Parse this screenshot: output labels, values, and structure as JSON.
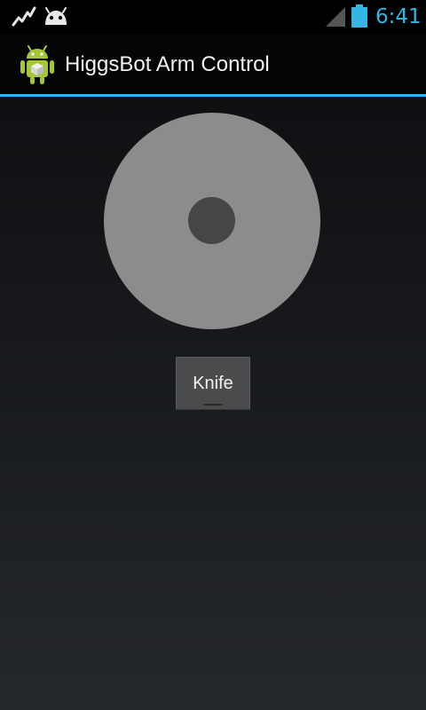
{
  "status_bar": {
    "time": "6:41",
    "icons": [
      "activity-notification-icon",
      "android-debug-icon",
      "cell-signal-icon",
      "battery-icon"
    ]
  },
  "action_bar": {
    "title": "HiggsBot Arm Control",
    "icon": "android-app-icon"
  },
  "colors": {
    "accent": "#33b5e5",
    "joystick_base": "#8c8c8c",
    "joystick_knob": "#464646"
  },
  "controls": {
    "joystick": {
      "icon": "joystick"
    },
    "toggle_button": {
      "label": "Knife",
      "checked": false
    }
  }
}
